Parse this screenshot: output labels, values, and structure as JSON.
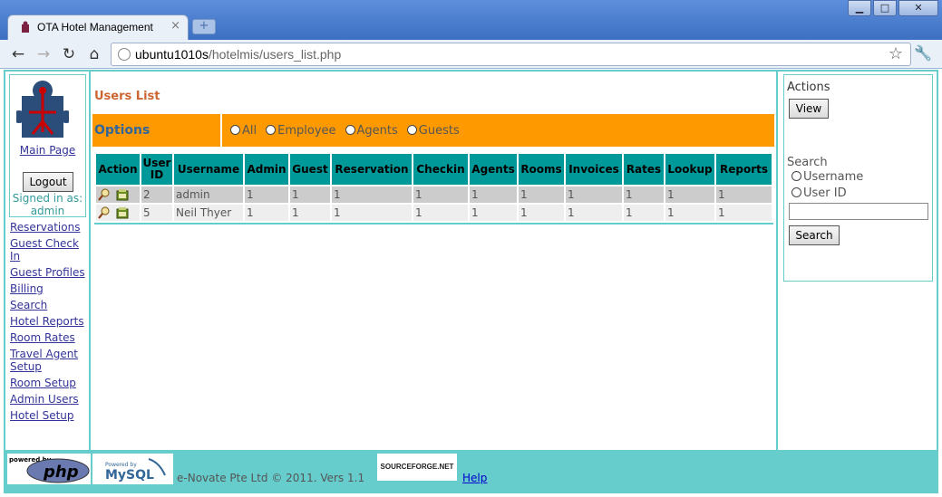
{
  "browser": {
    "tab_title": "OTA Hotel Management",
    "tab_close": "×",
    "new_tab": "+",
    "window_buttons": [
      "▁",
      "□",
      "✕"
    ],
    "url_host": "ubuntu1010s",
    "url_path": "/hotelmis/users_list.php"
  },
  "sidebar": {
    "main_page": "Main Page",
    "logout": "Logout",
    "signed_in_label": "Signed in as:",
    "signed_in_user": "admin",
    "items": [
      {
        "label": "Reservations"
      },
      {
        "label": "Guest Check In"
      },
      {
        "label": "Guest Profiles"
      },
      {
        "label": "Billing"
      },
      {
        "label": "Search"
      },
      {
        "label": "Hotel Reports"
      },
      {
        "label": "Room Rates"
      },
      {
        "label": "Travel Agent Setup"
      },
      {
        "label": "Room Setup"
      },
      {
        "label": "Admin Users"
      },
      {
        "label": "Hotel Setup"
      }
    ]
  },
  "main": {
    "title": "Users List",
    "options_label": "Options",
    "filters": [
      "All",
      "Employee",
      "Agents",
      "Guests"
    ],
    "columns": [
      "Action",
      "User ID",
      "Username",
      "Admin",
      "Guest",
      "Reservation",
      "Checkin",
      "Agents",
      "Rooms",
      "Invoices",
      "Rates",
      "Lookup",
      "Reports"
    ],
    "rows": [
      [
        "2",
        "admin",
        "1",
        "1",
        "1",
        "1",
        "1",
        "1",
        "1",
        "1",
        "1",
        "1"
      ],
      [
        "5",
        "Neil Thyer",
        "1",
        "1",
        "1",
        "1",
        "1",
        "1",
        "1",
        "1",
        "1",
        "1"
      ]
    ]
  },
  "right_panel": {
    "actions_label": "Actions",
    "view_button": "View",
    "search_label": "Search",
    "search_options": [
      "Username",
      "User ID"
    ],
    "search_value": "",
    "search_button": "Search"
  },
  "footer": {
    "copyright": "e-Novate Pte Ltd © 2011. Vers 1.1",
    "help": "Help",
    "sourceforge": "SOURCEFORGE.NET",
    "php_powered": "powered by",
    "php_logo": "php",
    "mysql_powered": "Powered by",
    "mysql_logo": "MySQL"
  },
  "colors": {
    "accent": "#66cccc",
    "header": "#009999",
    "options_bar": "#ff9900",
    "title": "#cc6633"
  },
  "icons": [
    "back-icon",
    "forward-icon",
    "reload-icon",
    "home-icon",
    "star-icon",
    "wrench-icon",
    "view-user-icon",
    "edit-user-icon",
    "puzzle-logo-icon"
  ]
}
